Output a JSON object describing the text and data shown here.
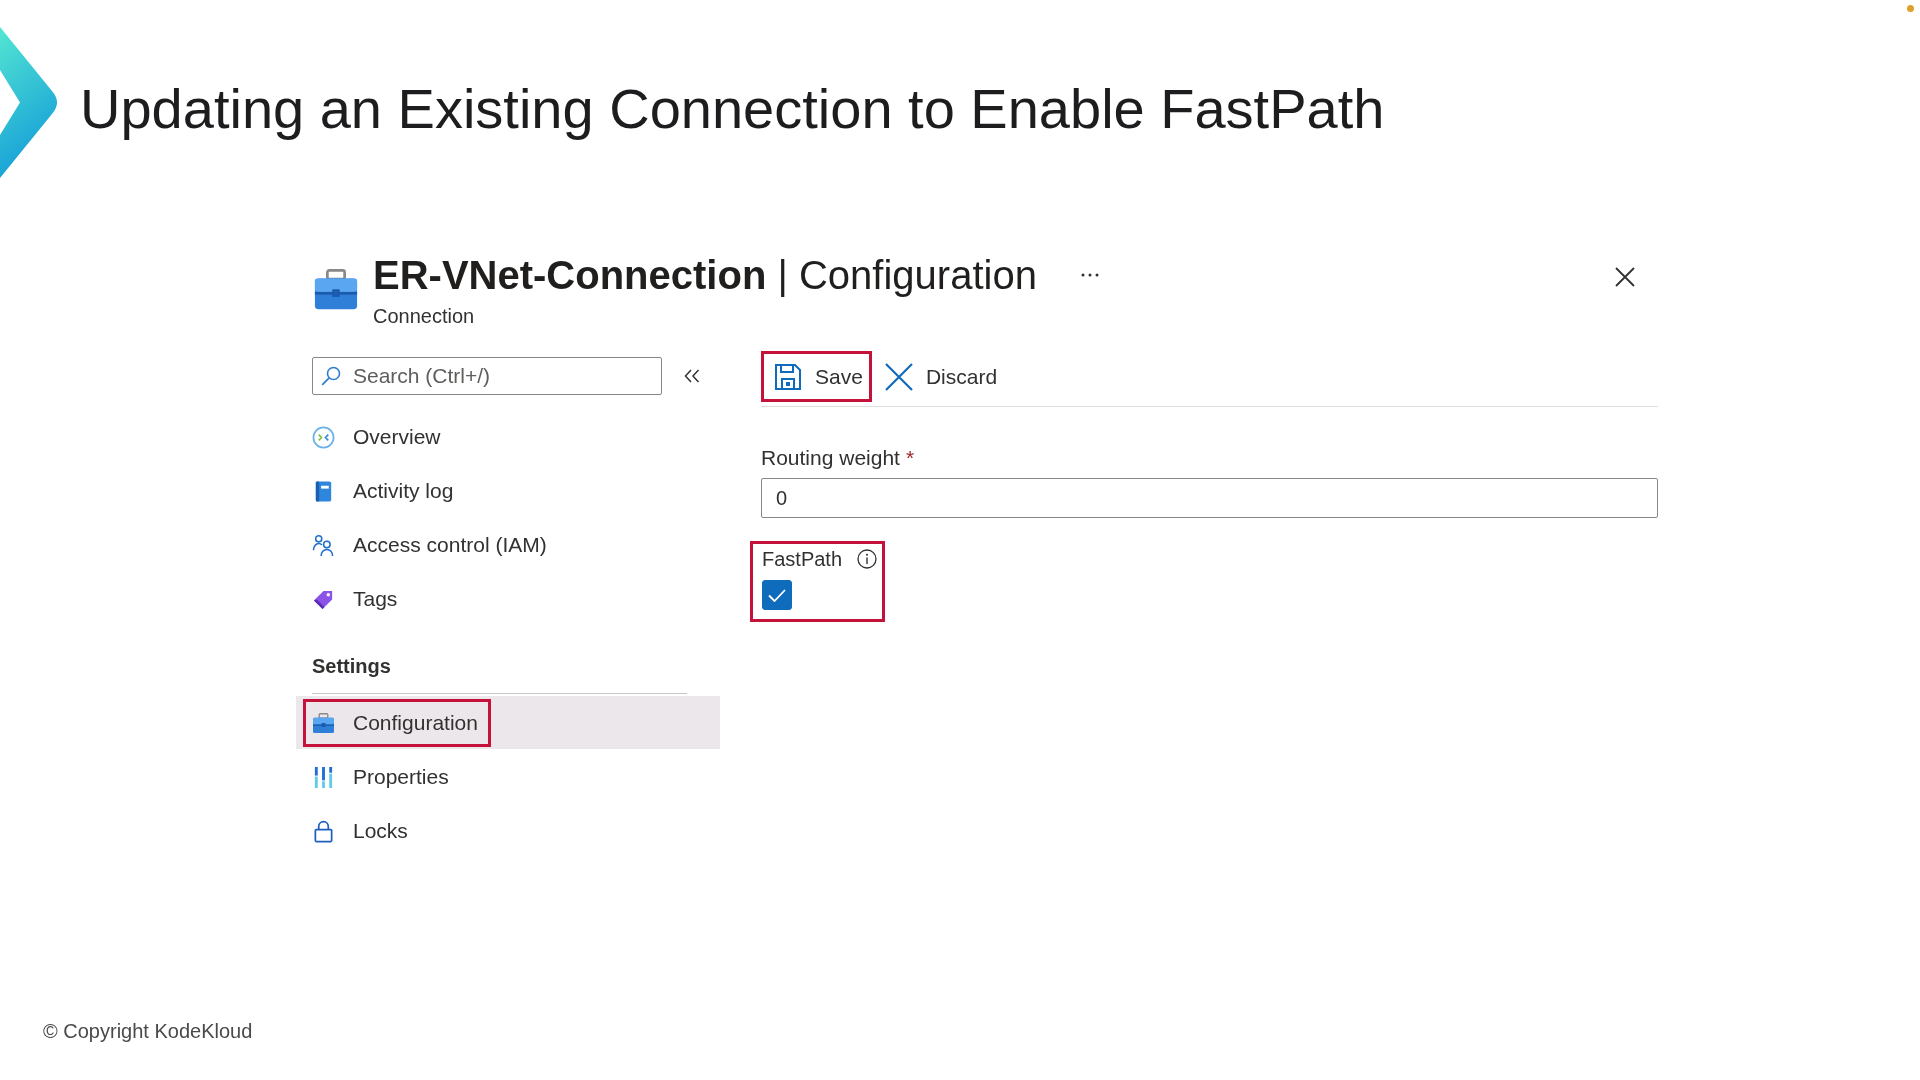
{
  "slide": {
    "title": "Updating an Existing Connection to Enable FastPath",
    "footer": "© Copyright KodeKloud"
  },
  "blade": {
    "title": "**ER-VNet-Connection** | Configuration",
    "subtitle": "Connection"
  },
  "sidebar": {
    "search": {
      "placeholder": "Search (Ctrl+/)"
    },
    "sections": [
      {
        "items": [
          {
            "kind": "overview",
            "label": "Overview",
            "selected": false,
            "highlighted": false
          },
          {
            "kind": "activity",
            "label": "Activity log",
            "selected": false,
            "highlighted": false
          },
          {
            "kind": "iam",
            "label": "Access control (IAM)",
            "selected": false,
            "highlighted": false
          },
          {
            "kind": "tags",
            "label": "Tags",
            "selected": false,
            "highlighted": false
          }
        ]
      },
      {
        "heading": "Settings",
        "items": [
          {
            "kind": "configuration",
            "label": "Configuration",
            "selected": true,
            "highlighted": true
          },
          {
            "kind": "properties",
            "label": "Properties",
            "selected": false,
            "highlighted": false
          },
          {
            "kind": "locks",
            "label": "Locks",
            "selected": false,
            "highlighted": false
          }
        ]
      }
    ]
  },
  "toolbar": {
    "buttons": [
      {
        "kind": "save",
        "label": "Save",
        "highlighted": true
      },
      {
        "kind": "discard",
        "label": "Discard",
        "highlighted": false
      }
    ]
  },
  "form": {
    "routing_weight": {
      "label": "Routing weight",
      "required_mark": "*",
      "value": "0"
    },
    "fastpath": {
      "label": "FastPath",
      "checked": true,
      "highlighted": true
    }
  }
}
